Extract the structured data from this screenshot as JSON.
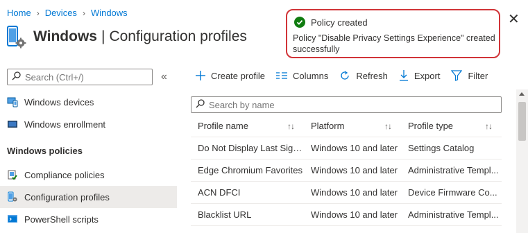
{
  "breadcrumb": {
    "items": [
      "Home",
      "Devices",
      "Windows"
    ]
  },
  "header": {
    "title_bold": "Windows",
    "title_rest": "Configuration profiles"
  },
  "sidebar": {
    "search_placeholder": "Search (Ctrl+/)",
    "collapse_label": "«",
    "items_top": [
      {
        "label": "Windows devices",
        "icon": "devices-icon"
      },
      {
        "label": "Windows enrollment",
        "icon": "enrollment-icon"
      }
    ],
    "section_header": "Windows policies",
    "items_policies": [
      {
        "label": "Compliance policies",
        "icon": "compliance-icon"
      },
      {
        "label": "Configuration profiles",
        "icon": "configuration-icon",
        "active": true
      },
      {
        "label": "PowerShell scripts",
        "icon": "powershell-icon"
      }
    ]
  },
  "toolbar": {
    "create_label": "Create profile",
    "columns_label": "Columns",
    "refresh_label": "Refresh",
    "export_label": "Export",
    "filter_label": "Filter"
  },
  "search": {
    "placeholder": "Search by name"
  },
  "table": {
    "columns": [
      "Profile name",
      "Platform",
      "Profile type"
    ],
    "rows": [
      [
        "Do Not Display Last Sign...",
        "Windows 10 and later",
        "Settings Catalog"
      ],
      [
        "Edge Chromium Favorites",
        "Windows 10 and later",
        "Administrative Templ..."
      ],
      [
        "ACN DFCI",
        "Windows 10 and later",
        "Device Firmware Co..."
      ],
      [
        "Blacklist URL",
        "Windows 10 and later",
        "Administrative Templ..."
      ]
    ]
  },
  "toast": {
    "title": "Policy created",
    "body": "Policy \"Disable Privacy Settings Experience\" created successfully",
    "status_color": "#107c10",
    "highlight_color": "#d13438"
  },
  "colors": {
    "accent": "#0078d4",
    "active_nav": "#edebe9"
  }
}
